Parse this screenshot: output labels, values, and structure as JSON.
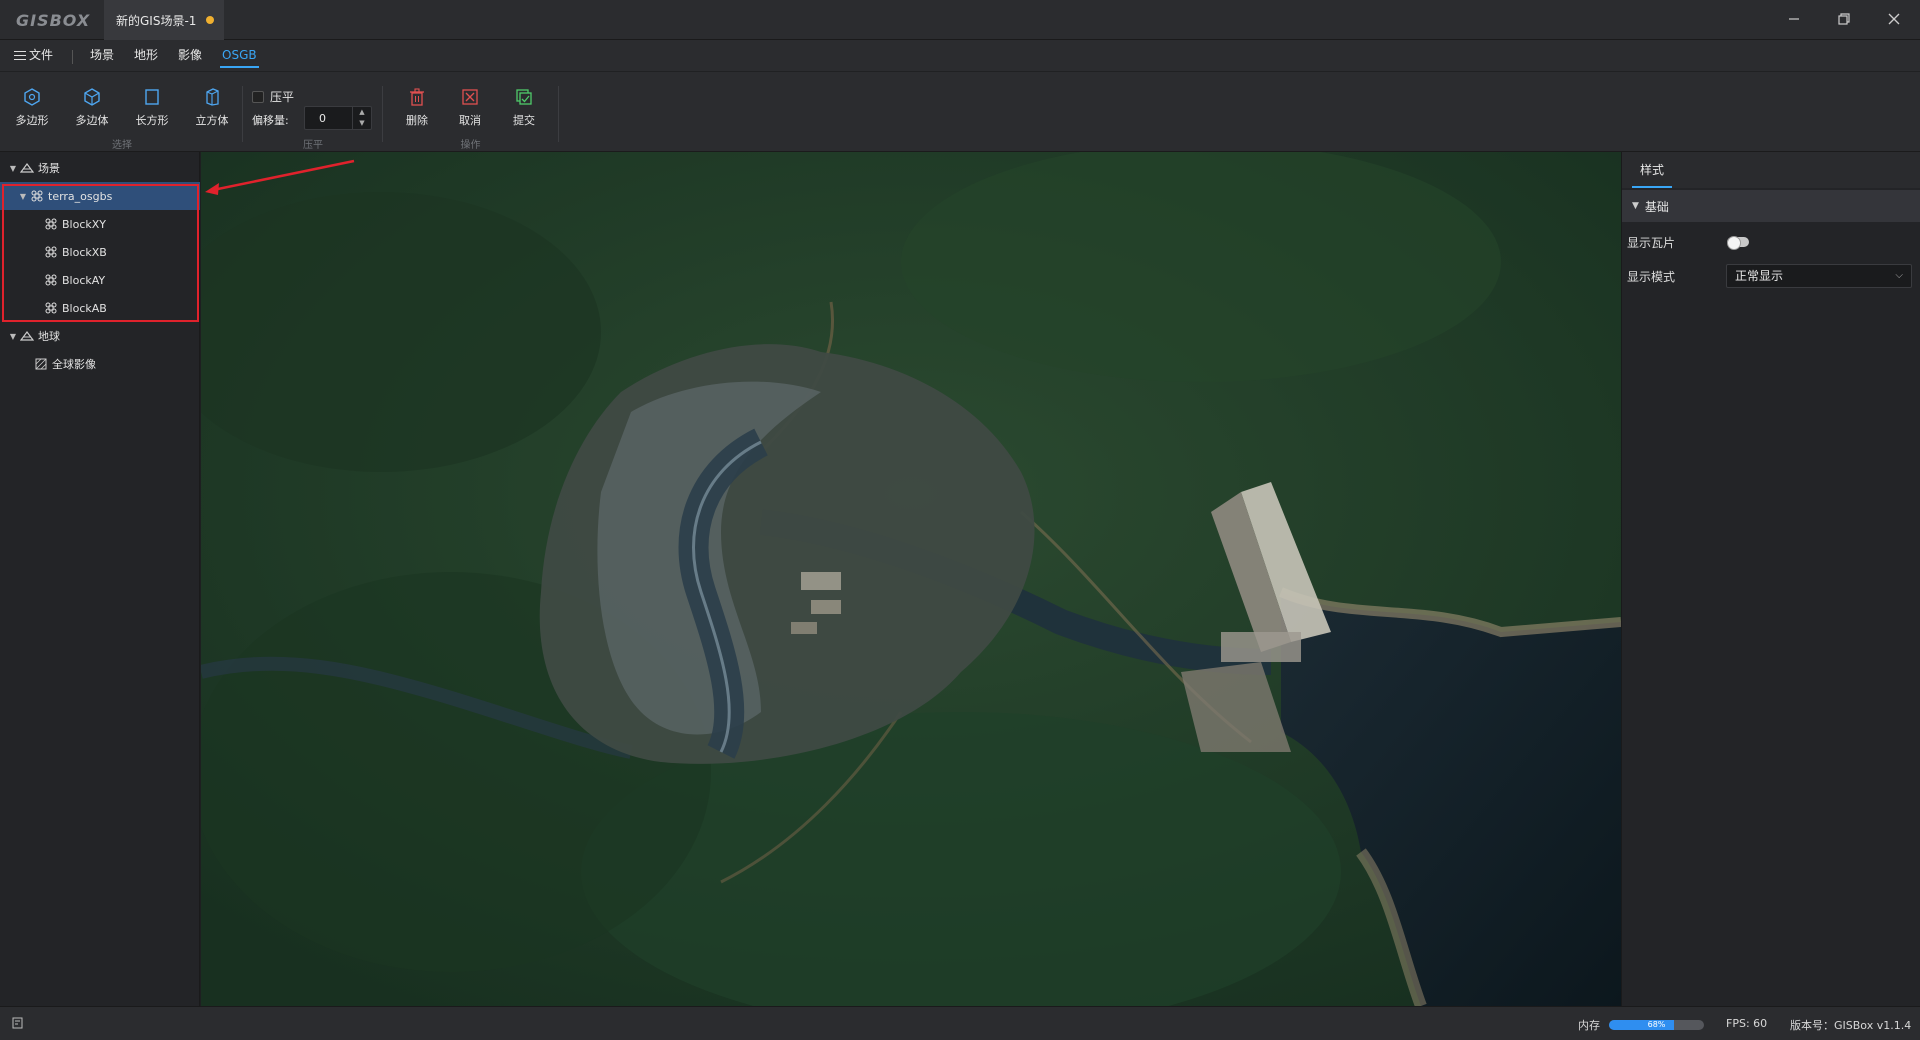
{
  "app": {
    "logo": "GISBOX",
    "tab_title": "新的GIS场景-1",
    "window_controls": [
      "minimize-icon",
      "restore-icon",
      "close-icon"
    ]
  },
  "menu": {
    "file_label": "文件",
    "items": [
      {
        "label": "场景",
        "active": false
      },
      {
        "label": "地形",
        "active": false
      },
      {
        "label": "影像",
        "active": false
      },
      {
        "label": "OSGB",
        "active": true
      }
    ]
  },
  "toolbar": {
    "select_group_label": "选择",
    "select_tools": [
      {
        "label": "多边形",
        "icon": "hexagon-icon"
      },
      {
        "label": "多边体",
        "icon": "cube-icon"
      },
      {
        "label": "长方形",
        "icon": "rectangle-icon"
      },
      {
        "label": "立方体",
        "icon": "box-icon"
      }
    ],
    "flatten_group_label": "压平",
    "flatten_checkbox_label": "压平",
    "flatten_checked": false,
    "offset_label": "偏移量:",
    "offset_value": "0",
    "action_group_label": "操作",
    "actions": [
      {
        "label": "删除",
        "icon": "trash-icon"
      },
      {
        "label": "取消",
        "icon": "cancel-icon"
      },
      {
        "label": "提交",
        "icon": "submit-icon"
      }
    ]
  },
  "tree": {
    "scene_label": "场景",
    "scene_root": "terra_osgbs",
    "blocks": [
      "BlockXY",
      "BlockXB",
      "BlockAY",
      "BlockAB"
    ],
    "earth_label": "地球",
    "earth_children": [
      "全球影像"
    ]
  },
  "right_panel": {
    "tab_label": "样式",
    "section_label": "基础",
    "show_tiles_label": "显示瓦片",
    "show_tiles_on": false,
    "display_mode_label": "显示模式",
    "display_mode_value": "正常显示"
  },
  "status": {
    "memory_label": "内存",
    "memory_percent": 68,
    "memory_text": "68%",
    "fps_text": "FPS: 60",
    "version_text": "版本号：GISBox v1.1.4"
  },
  "colors": {
    "accent": "#39a6f5",
    "selection": "#2f4f7a",
    "highlight_box": "#e0222c",
    "modified_dot": "#f0b030"
  }
}
